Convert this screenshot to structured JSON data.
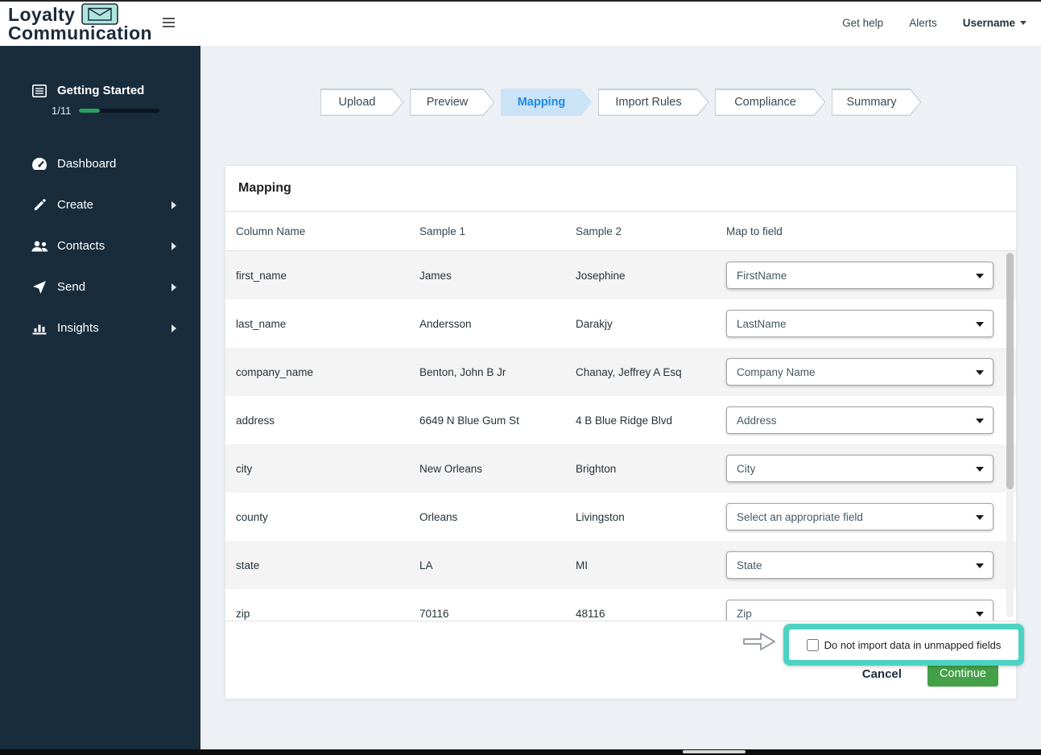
{
  "colors": {
    "sidebar_bg": "#182c3c",
    "accent_blue": "#1e88e5",
    "active_step_bg": "#cbe3f6",
    "continue_green": "#43a047",
    "highlight_teal": "#4cd3c2",
    "progress_green": "#2fa05e",
    "logo_envelope_teal": "#aee6dd"
  },
  "header": {
    "logo_line1": "Loyalty",
    "logo_line2": "Communication",
    "get_help": "Get help",
    "alerts": "Alerts",
    "username": "Username"
  },
  "sidebar": {
    "getting_started": {
      "label": "Getting Started",
      "progress_text": "1/11"
    },
    "items": [
      {
        "label": "Dashboard"
      },
      {
        "label": "Create"
      },
      {
        "label": "Contacts"
      },
      {
        "label": "Send"
      },
      {
        "label": "Insights"
      }
    ]
  },
  "stepper": {
    "active": "Mapping",
    "steps": [
      {
        "label": "Upload"
      },
      {
        "label": "Preview"
      },
      {
        "label": "Mapping"
      },
      {
        "label": "Import Rules"
      },
      {
        "label": "Compliance"
      },
      {
        "label": "Summary"
      }
    ]
  },
  "mapping": {
    "title": "Mapping",
    "columns": [
      "Column Name",
      "Sample 1",
      "Sample 2",
      "Map to field"
    ],
    "rows": [
      {
        "name": "first_name",
        "s1": "James",
        "s2": "Josephine",
        "field": "FirstName"
      },
      {
        "name": "last_name",
        "s1": "Andersson",
        "s2": "Darakjy",
        "field": "LastName"
      },
      {
        "name": "company_name",
        "s1": "Benton, John B Jr",
        "s2": "Chanay, Jeffrey A Esq",
        "field": "Company Name"
      },
      {
        "name": "address",
        "s1": "6649 N Blue Gum St",
        "s2": "4 B Blue Ridge Blvd",
        "field": "Address"
      },
      {
        "name": "city",
        "s1": "New Orleans",
        "s2": "Brighton",
        "field": "City"
      },
      {
        "name": "county",
        "s1": "Orleans",
        "s2": "Livingston",
        "field": "Select an appropriate field"
      },
      {
        "name": "state",
        "s1": "LA",
        "s2": "MI",
        "field": "State"
      },
      {
        "name": "zip",
        "s1": "70116",
        "s2": "48116",
        "field": "Zip"
      }
    ],
    "footer": {
      "checkbox_label": "Do not import data in unmapped fields",
      "cancel": "Cancel",
      "continue": "Continue"
    }
  }
}
